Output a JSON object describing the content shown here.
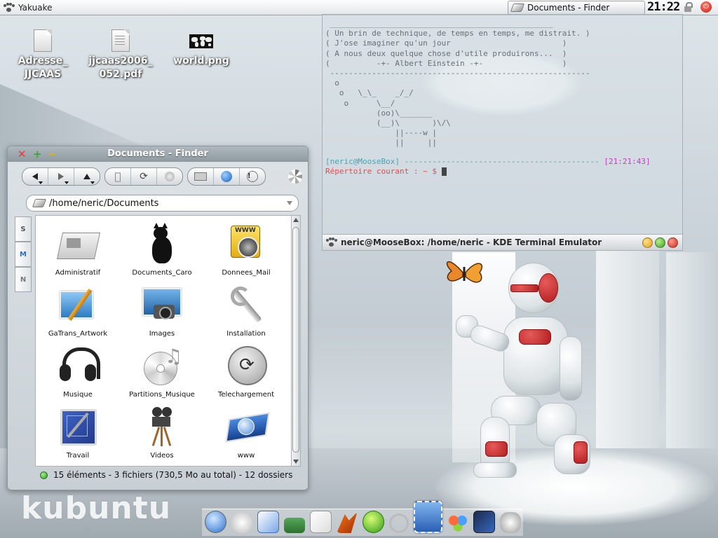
{
  "top_panel": {
    "app_name": "Yakuake",
    "task_window": "Documents - Finder",
    "clock": "21:22"
  },
  "desktop": {
    "icons": [
      {
        "label_line1": "Adresse_",
        "label_line2": "JJCAAS",
        "type": "document-icon"
      },
      {
        "label_line1": "jjcaas2006_",
        "label_line2": "052.pdf",
        "type": "pdf-icon"
      },
      {
        "label_line1": "world.png",
        "label_line2": "",
        "type": "image-icon"
      }
    ],
    "wallpaper_logo": "kubuntu"
  },
  "terminal": {
    "title": "neric@MooseBox: /home/neric - KDE Terminal Emulator",
    "fortune": " ________________________________________________\n( Un brin de technique, de temps en temps, me distrait. )\n( J'ose imaginer qu'un jour                        )\n( A nous deux quelque chose d'utile produirons...  )\n(          -+- Albert Einstein -+-                 )\n --------------------------------------------------------\n  o\n   o   \\_\\_    _/_/\n    o      \\__/\n           (oo)\\_______\n           (__)\\       )\\/\\\n               ||----w |\n               ||     ||",
    "prompt_user": "[neric@MooseBox]",
    "prompt_dashes": " ------------------------------------------ ",
    "prompt_time": "[21:21:43]",
    "prompt_dir_label": "Répertoire courant :",
    "prompt_dir": " ~ $ ",
    "colors": {
      "user": "#4aa3b5",
      "time": "#c040c0",
      "dir": "#e05050"
    }
  },
  "finder": {
    "title": "Documents - Finder",
    "path": "/home/neric/Documents",
    "side_tabs": [
      "S",
      "M",
      "N"
    ],
    "items": [
      {
        "label": "Administratif",
        "icon": "newspaper-icon"
      },
      {
        "label": "Documents_Caro",
        "icon": "black-cat-icon"
      },
      {
        "label": "Donnees_Mail",
        "icon": "mail-www-icon"
      },
      {
        "label": "GaTrans_Artwork",
        "icon": "artwork-pen-icon"
      },
      {
        "label": "Images",
        "icon": "camera-photo-icon"
      },
      {
        "label": "Installation",
        "icon": "wrench-icon"
      },
      {
        "label": "Musique",
        "icon": "headphones-icon"
      },
      {
        "label": "Partitions_Musique",
        "icon": "music-cd-icon"
      },
      {
        "label": "Telechargement",
        "icon": "sync-icon"
      },
      {
        "label": "Travail",
        "icon": "blueprint-icon"
      },
      {
        "label": "Videos",
        "icon": "movie-camera-icon"
      },
      {
        "label": "www",
        "icon": "safari-globe-icon"
      }
    ],
    "status": "15 éléments - 3 fichiers (730,5 Mo au total) - 12 dossiers"
  },
  "dock": {
    "items": [
      "safari-icon",
      "apple-icon",
      "textedit-icon",
      "books-icon",
      "font-book-icon",
      "matlab-icon",
      "skype-icon",
      "search-icon",
      "mail-stamp-icon",
      "msn-icon",
      "imovie-icon",
      "speaker-icon"
    ]
  }
}
